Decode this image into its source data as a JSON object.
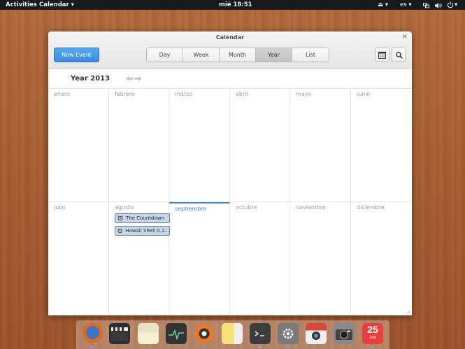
{
  "top_panel": {
    "activities": "Activities",
    "app_menu": "Calendar ▾",
    "clock": "mié 18:51",
    "eject": "⏏ ▾",
    "language": "es ▾"
  },
  "window": {
    "title": "Calendar",
    "close": "×",
    "new_event": "New Event",
    "views": [
      {
        "label": "Day",
        "active": false
      },
      {
        "label": "Week",
        "active": false
      },
      {
        "label": "Month",
        "active": false
      },
      {
        "label": "Year",
        "active": true
      },
      {
        "label": "List",
        "active": false
      }
    ],
    "year_label": "Year 2013",
    "months": [
      {
        "name": "enero"
      },
      {
        "name": "febrero"
      },
      {
        "name": "marzo"
      },
      {
        "name": "abril"
      },
      {
        "name": "mayo"
      },
      {
        "name": "junio"
      },
      {
        "name": "julio"
      },
      {
        "name": "agosto"
      },
      {
        "name": "septiembre",
        "current": true
      },
      {
        "name": "octubre"
      },
      {
        "name": "noviembre"
      },
      {
        "name": "diciembre"
      }
    ],
    "events": [
      {
        "month": "agosto",
        "title": "The Countdown"
      },
      {
        "month": "agosto",
        "title": "Hawaii Shell 0.1..."
      }
    ]
  },
  "dock": {
    "calendar_day": "25",
    "calendar_month": "JUN"
  },
  "colors": {
    "accent": "#3d8ae0",
    "event_bg": "#c6d7ea"
  }
}
